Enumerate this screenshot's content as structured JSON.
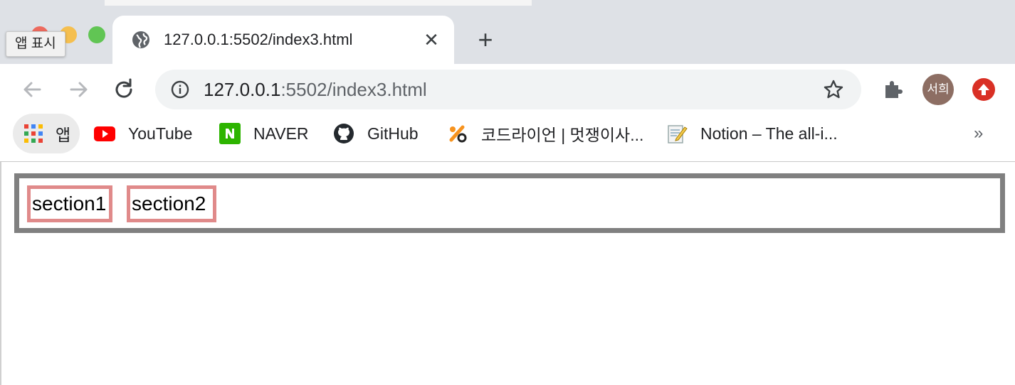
{
  "tooltip": {
    "text": "앱 표시"
  },
  "tab": {
    "title": "127.0.0.1:5502/index3.html",
    "favicon": "globe-icon",
    "close": "✕"
  },
  "new_tab": "+",
  "omnibox": {
    "host": "127.0.0.1",
    "path": ":5502/index3.html",
    "icon": "info-icon"
  },
  "profile": {
    "avatar_text": "서희"
  },
  "bookmarks": {
    "items": [
      {
        "label": "앱",
        "icon": "apps-grid-icon"
      },
      {
        "label": "YouTube",
        "icon": "youtube-icon"
      },
      {
        "label": "NAVER",
        "icon": "naver-icon"
      },
      {
        "label": "GitHub",
        "icon": "github-icon"
      },
      {
        "label": "코드라이언 | 멋쟁이사...",
        "icon": "codelion-icon"
      },
      {
        "label": "Notion – The all-i...",
        "icon": "notion-icon"
      }
    ],
    "more": "»"
  },
  "page": {
    "sections": [
      {
        "label": "section1"
      },
      {
        "label": "section2"
      }
    ]
  },
  "colors": {
    "chrome_bg": "#dee1e6",
    "box_border": "#808080",
    "section_border": "#e08a8a",
    "avatar_bg": "#8d6e63",
    "update_bg": "#d93025"
  }
}
